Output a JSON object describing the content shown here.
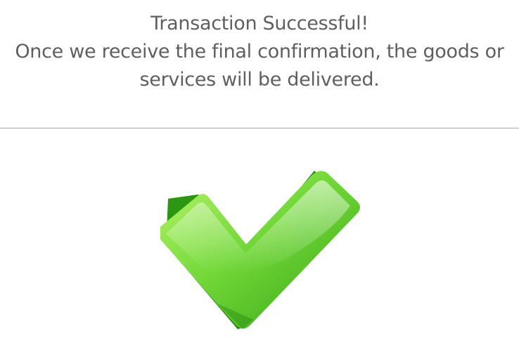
{
  "confirmation": {
    "title": "Transaction Successful!",
    "message_line1": "Once we receive the final confirmation, the goods or",
    "message_line2": "services will be delivered."
  },
  "success_icon": {
    "name": "checkmark-icon",
    "colors": {
      "light_green": "#a6ef5a",
      "mid_green": "#5cc72a",
      "dark_green": "#1f8c0a"
    }
  }
}
